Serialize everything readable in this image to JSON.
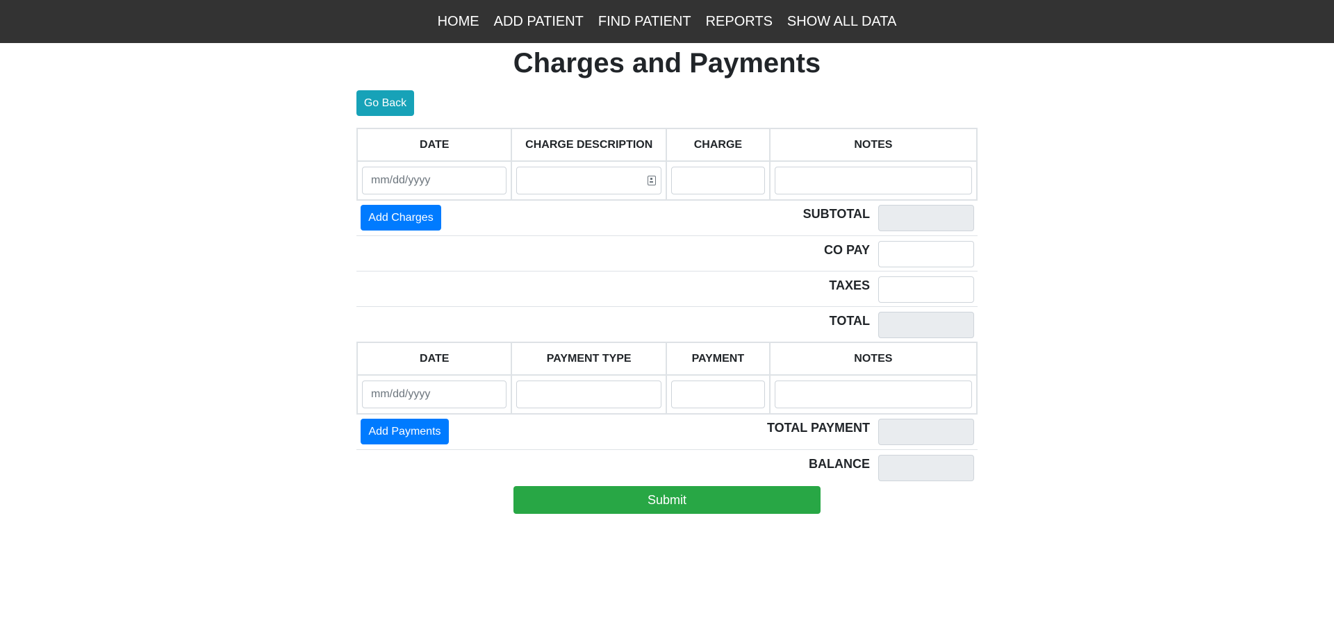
{
  "nav": {
    "items": [
      "HOME",
      "ADD PATIENT",
      "FIND PATIENT",
      "REPORTS",
      "SHOW ALL DATA"
    ]
  },
  "page_title": "Charges and Payments",
  "go_back_label": "Go Back",
  "charges_table": {
    "headers": [
      "DATE",
      "CHARGE DESCRIPTION",
      "CHARGE",
      "NOTES"
    ],
    "date_placeholder": "mm/dd/yyyy",
    "description_value": "",
    "charge_value": "",
    "notes_value": ""
  },
  "add_charges_label": "Add Charges",
  "charge_summary": {
    "subtotal_label": "SUBTOTAL",
    "copay_label": "CO PAY",
    "taxes_label": "TAXES",
    "total_label": "TOTAL"
  },
  "payments_table": {
    "headers": [
      "DATE",
      "PAYMENT TYPE",
      "PAYMENT",
      "NOTES"
    ],
    "date_placeholder": "mm/dd/yyyy",
    "payment_type_value": "",
    "payment_value": "",
    "notes_value": ""
  },
  "add_payments_label": "Add Payments",
  "payment_summary": {
    "total_payment_label": "TOTAL PAYMENT",
    "balance_label": "BALANCE"
  },
  "submit_label": "Submit",
  "colors": {
    "navbar": "#333333",
    "go_back": "#17a2b8",
    "primary": "#007bff",
    "submit": "#28a745",
    "readonly_field": "#e9ecef"
  }
}
